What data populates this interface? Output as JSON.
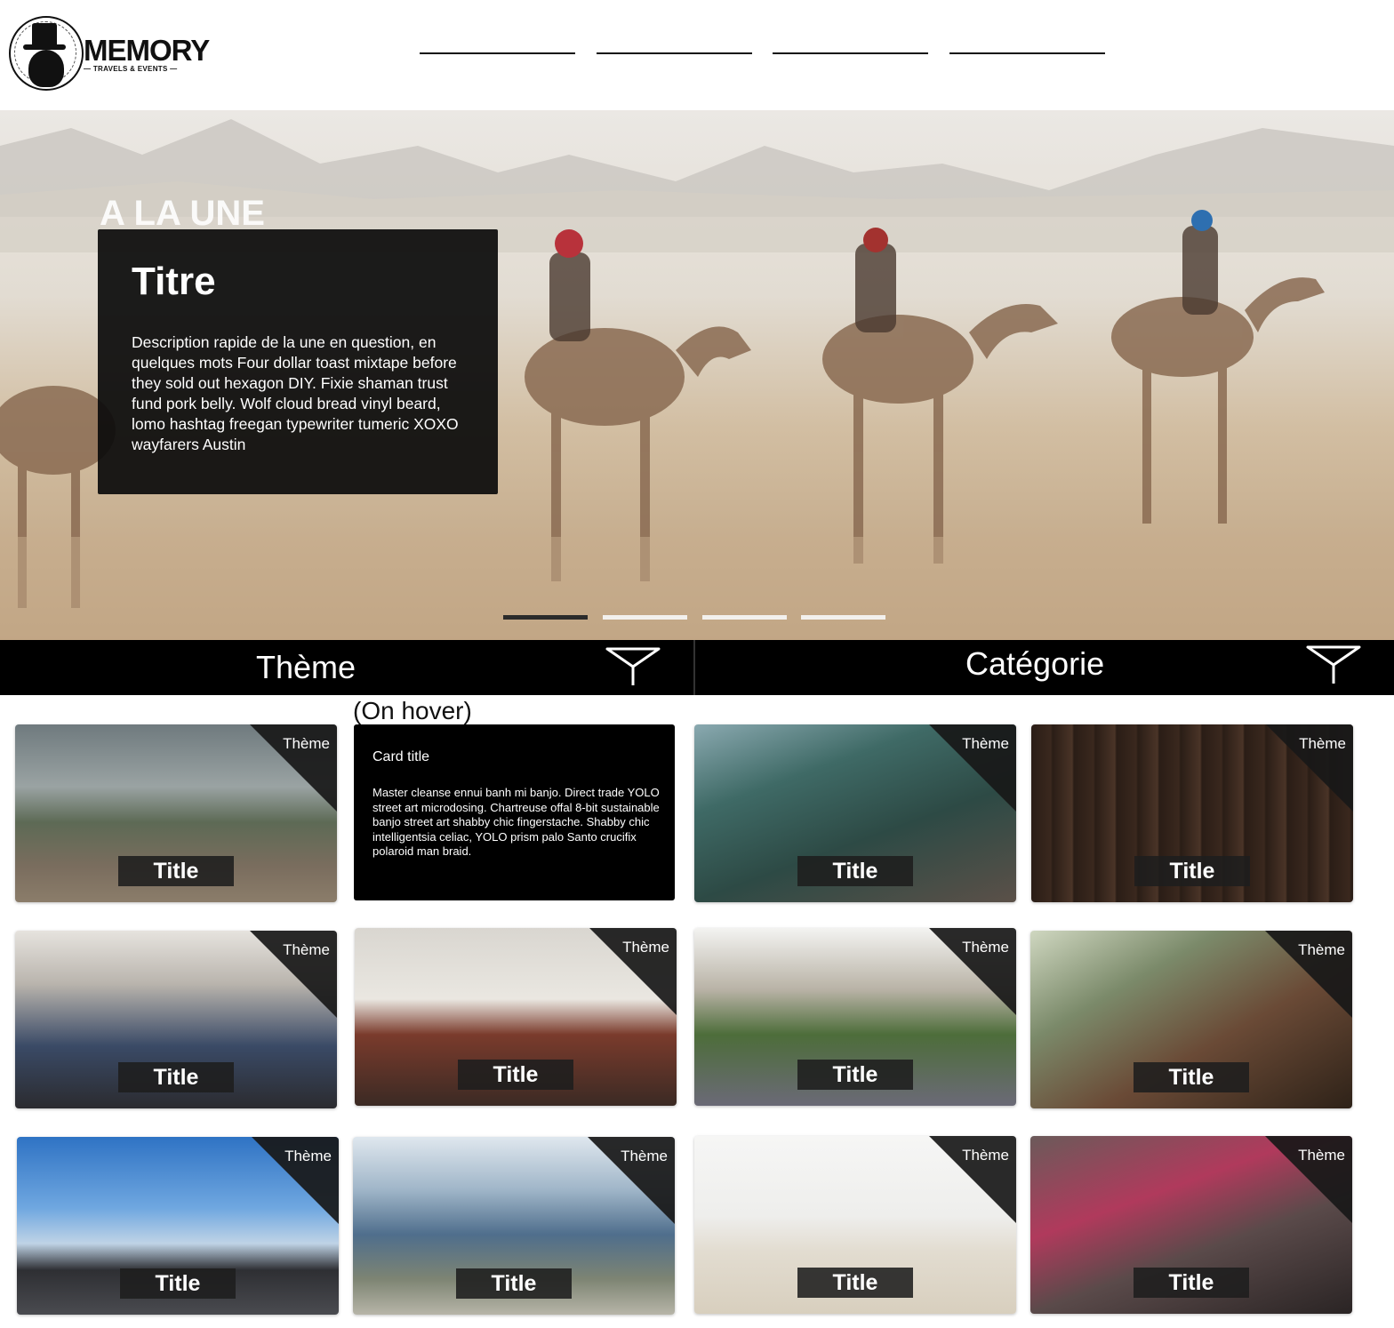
{
  "header": {
    "logo_word": "MEMORY",
    "logo_sub": "— TRAVELS & EVENTS —",
    "nav_items": [
      "",
      "",
      "",
      ""
    ]
  },
  "hero": {
    "section_label": "A LA UNE",
    "card_title": "Titre",
    "card_description": "Description rapide de la une en question, en quelques mots Four dollar toast mixtape before they sold out hexagon DIY. Fixie shaman trust fund pork belly. Wolf cloud bread vinyl beard, lomo hashtag freegan typewriter tumeric XOXO wayfarers Austin",
    "slides_total": 4,
    "active_slide": 1
  },
  "filters": {
    "theme_label": "Thème",
    "category_label": "Catégorie",
    "icon": "funnel-filter-icon"
  },
  "hover_note": "(On hover)",
  "hover_card": {
    "title": "Card title",
    "text": "Master cleanse ennui banh mi banjo. Direct trade YOLO street art microdosing. Chartreuse offal 8-bit sustainable banjo street art shabby chic fingerstache. Shabby chic intelligentsia celiac, YOLO prism palo Santo crucifix polaroid man braid."
  },
  "cards": [
    {
      "theme": "Thème",
      "title": "Title",
      "scene": "train"
    },
    {
      "theme": "Thème",
      "title": "Title",
      "scene": "nets"
    },
    {
      "theme": "Thème",
      "title": "Title",
      "scene": "wood"
    },
    {
      "theme": "Thème",
      "title": "Title",
      "scene": "plane"
    },
    {
      "theme": "Thème",
      "title": "Title",
      "scene": "roof"
    },
    {
      "theme": "Thème",
      "title": "Title",
      "scene": "castle"
    },
    {
      "theme": "Thème",
      "title": "Title",
      "scene": "wine"
    },
    {
      "theme": "Thème",
      "title": "Title",
      "scene": "car"
    },
    {
      "theme": "Thème",
      "title": "Title",
      "scene": "mountain"
    },
    {
      "theme": "Thème",
      "title": "Title",
      "scene": "pineapple"
    },
    {
      "theme": "Thème",
      "title": "Title",
      "scene": "street"
    }
  ]
}
